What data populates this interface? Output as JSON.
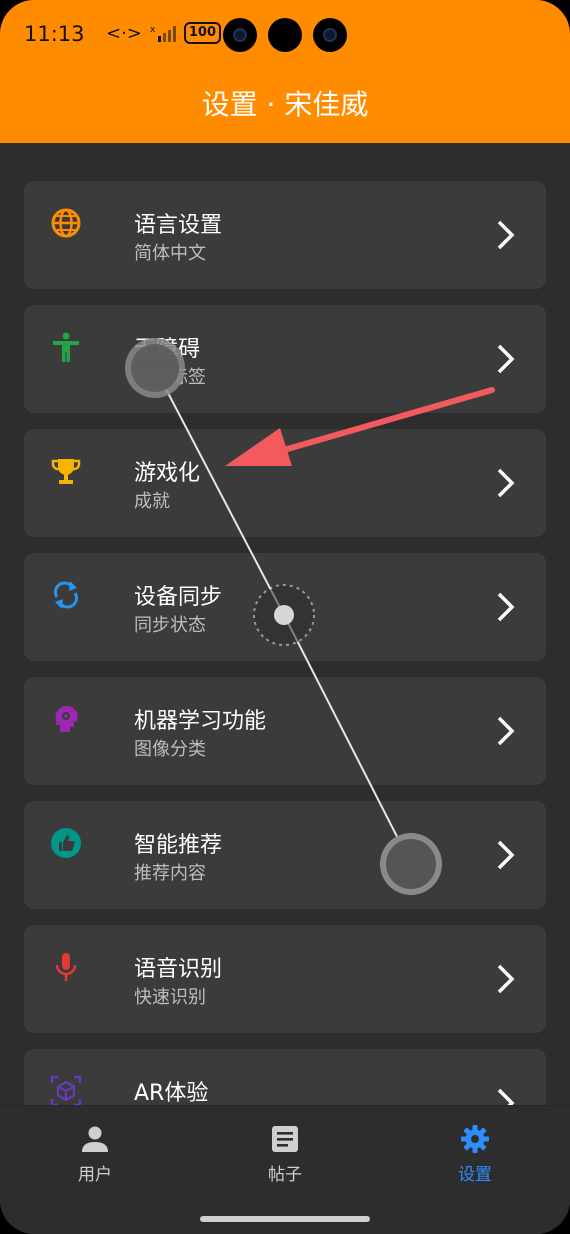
{
  "status": {
    "time": "11:13",
    "battery": "100"
  },
  "header": {
    "title": "设置 · 宋佳威"
  },
  "settings": [
    {
      "label": "语言设置",
      "sub": "简体中文",
      "icon": "globe-icon",
      "color": "#ff8c00"
    },
    {
      "label": "无障碍",
      "sub": "语义标签",
      "icon": "accessibility-icon",
      "color": "#22a447"
    },
    {
      "label": "游戏化",
      "sub": "成就",
      "icon": "trophy-icon",
      "color": "#f4b400"
    },
    {
      "label": "设备同步",
      "sub": "同步状态",
      "icon": "sync-icon",
      "color": "#2196f3"
    },
    {
      "label": "机器学习功能",
      "sub": "图像分类",
      "icon": "brain-icon",
      "color": "#9c27b0"
    },
    {
      "label": "智能推荐",
      "sub": "推荐内容",
      "icon": "thumb-up-icon",
      "color": "#009688"
    },
    {
      "label": "语音识别",
      "sub": "快速识别",
      "icon": "microphone-icon",
      "color": "#e53935"
    },
    {
      "label": "AR体验",
      "sub": "",
      "icon": "ar-cube-icon",
      "color": "#673ab7"
    }
  ],
  "tabs": [
    {
      "label": "用户",
      "icon": "person-icon"
    },
    {
      "label": "帖子",
      "icon": "article-icon"
    },
    {
      "label": "设置",
      "icon": "gear-icon",
      "active": true
    }
  ],
  "colors": {
    "header": "#ff8c00",
    "background": "#2d2d2d",
    "card": "#3b3b3b",
    "active_tab": "#2f8cff",
    "annotation_arrow": "#f25a5e"
  }
}
